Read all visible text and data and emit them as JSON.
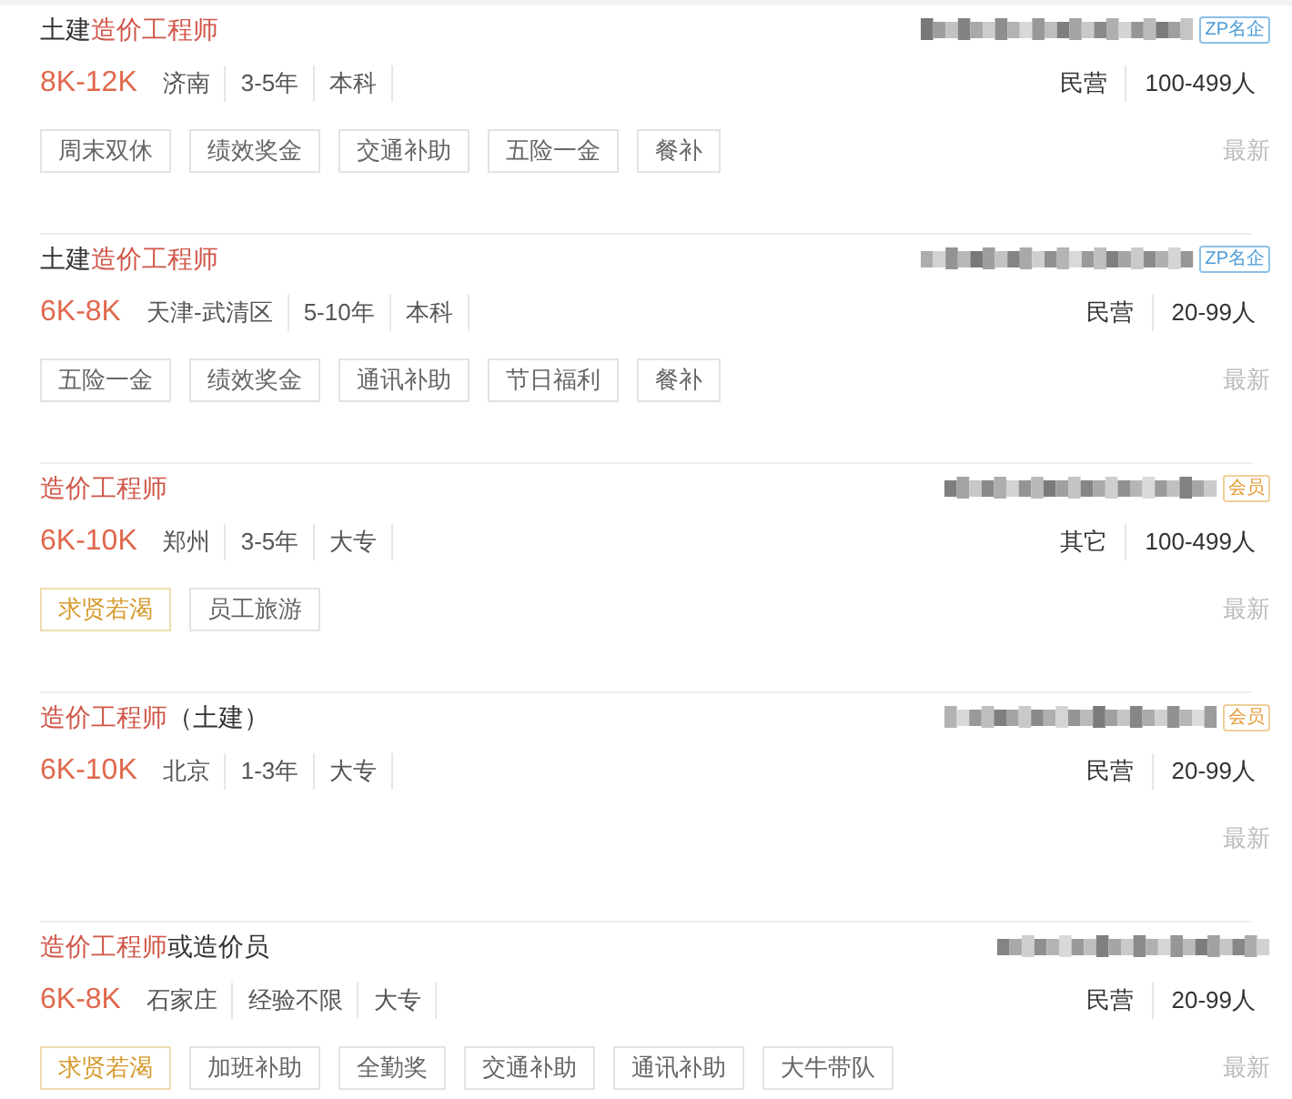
{
  "jobs": [
    {
      "title": [
        {
          "text": "土建",
          "highlight": false
        },
        {
          "text": "造价工程师",
          "highlight": true
        }
      ],
      "badge": {
        "text": "ZP名企",
        "kind": "famous"
      },
      "salary": "8K-12K",
      "requirements": [
        "济南",
        "3-5年",
        "本科"
      ],
      "company_info": [
        "民营",
        "100-499人"
      ],
      "tags": [
        {
          "text": "周末双休",
          "kind": "normal"
        },
        {
          "text": "绩效奖金",
          "kind": "normal"
        },
        {
          "text": "交通补助",
          "kind": "normal"
        },
        {
          "text": "五险一金",
          "kind": "normal"
        },
        {
          "text": "餐补",
          "kind": "normal"
        }
      ],
      "freshness": "最新"
    },
    {
      "title": [
        {
          "text": "土建",
          "highlight": false
        },
        {
          "text": "造价工程师",
          "highlight": true
        }
      ],
      "badge": {
        "text": "ZP名企",
        "kind": "famous"
      },
      "salary": "6K-8K",
      "requirements": [
        "天津-武清区",
        "5-10年",
        "本科"
      ],
      "company_info": [
        "民营",
        "20-99人"
      ],
      "tags": [
        {
          "text": "五险一金",
          "kind": "normal"
        },
        {
          "text": "绩效奖金",
          "kind": "normal"
        },
        {
          "text": "通讯补助",
          "kind": "normal"
        },
        {
          "text": "节日福利",
          "kind": "normal"
        },
        {
          "text": "餐补",
          "kind": "normal"
        }
      ],
      "freshness": "最新"
    },
    {
      "title": [
        {
          "text": "造价工程师",
          "highlight": true
        }
      ],
      "badge": {
        "text": "会员",
        "kind": "member"
      },
      "salary": "6K-10K",
      "requirements": [
        "郑州",
        "3-5年",
        "大专"
      ],
      "company_info": [
        "其它",
        "100-499人"
      ],
      "tags": [
        {
          "text": "求贤若渴",
          "kind": "urgent"
        },
        {
          "text": "员工旅游",
          "kind": "normal"
        }
      ],
      "freshness": "最新"
    },
    {
      "title": [
        {
          "text": "造价工程师",
          "highlight": true
        },
        {
          "text": "（土建）",
          "highlight": false
        }
      ],
      "badge": {
        "text": "会员",
        "kind": "member"
      },
      "salary": "6K-10K",
      "requirements": [
        "北京",
        "1-3年",
        "大专"
      ],
      "company_info": [
        "民营",
        "20-99人"
      ],
      "freshness": "最新"
    },
    {
      "title": [
        {
          "text": "造价工程师",
          "highlight": true
        },
        {
          "text": "或造价员",
          "highlight": false
        }
      ],
      "salary": "6K-8K",
      "requirements": [
        "石家庄",
        "经验不限",
        "大专"
      ],
      "company_info": [
        "民营",
        "20-99人"
      ],
      "tags": [
        {
          "text": "求贤若渴",
          "kind": "urgent"
        },
        {
          "text": "加班补助",
          "kind": "normal"
        },
        {
          "text": "全勤奖",
          "kind": "normal"
        },
        {
          "text": "交通补助",
          "kind": "normal"
        },
        {
          "text": "通讯补助",
          "kind": "normal"
        },
        {
          "text": "大牛带队",
          "kind": "normal"
        }
      ],
      "freshness": "最新"
    }
  ]
}
